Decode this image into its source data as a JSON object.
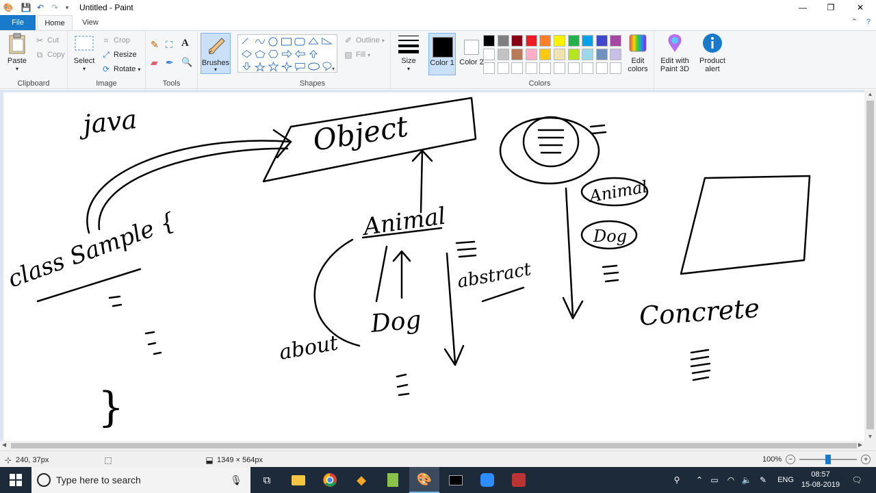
{
  "app": {
    "title": "Untitled - Paint"
  },
  "window_controls": {
    "minimize": "—",
    "restore": "❐",
    "close": "✕"
  },
  "tabs": [
    {
      "label": "File"
    },
    {
      "label": "Home"
    },
    {
      "label": "View"
    }
  ],
  "ribbon": {
    "clipboard": {
      "label": "Clipboard",
      "paste": "Paste",
      "cut": "Cut",
      "copy": "Copy"
    },
    "image": {
      "label": "Image",
      "select": "Select",
      "crop": "Crop",
      "resize": "Resize",
      "rotate": "Rotate"
    },
    "tools": {
      "label": "Tools"
    },
    "brushes": {
      "label": "Brushes"
    },
    "shapes": {
      "label": "Shapes",
      "outline": "Outline",
      "fill": "Fill"
    },
    "size": {
      "label": "Size"
    },
    "colors": {
      "label": "Colors",
      "color1_label": "Color 1",
      "color2_label": "Color 2",
      "color1": "#000000",
      "color2": "#ffffff",
      "edit_colors": "Edit colors",
      "palette_row1": [
        "#000000",
        "#7f7f7f",
        "#880015",
        "#ed1c24",
        "#ff7f27",
        "#fff200",
        "#22b14c",
        "#00a2e8",
        "#3f48cc",
        "#a349a4"
      ],
      "palette_row2": [
        "#ffffff",
        "#c3c3c3",
        "#b97a57",
        "#ffaec9",
        "#ffc90e",
        "#efe4b0",
        "#b5e61d",
        "#99d9ea",
        "#7092be",
        "#c8bfe7"
      ]
    },
    "paint3d": {
      "label": "Edit with Paint 3D"
    },
    "product_alert": {
      "label": "Product alert"
    }
  },
  "canvas": {
    "drawing_texts": [
      "java",
      "Object",
      "class Sample {",
      "}",
      "Animal",
      "Dog",
      "abstract",
      "Concrete",
      "Animal",
      "Dog"
    ]
  },
  "status": {
    "cursor_pos": "240, 37px",
    "canvas_size": "1349 × 564px",
    "zoom": "100%"
  },
  "taskbar": {
    "search_placeholder": "Type here to search",
    "language": "ENG",
    "time": "08:57",
    "date": "15-08-2019"
  }
}
